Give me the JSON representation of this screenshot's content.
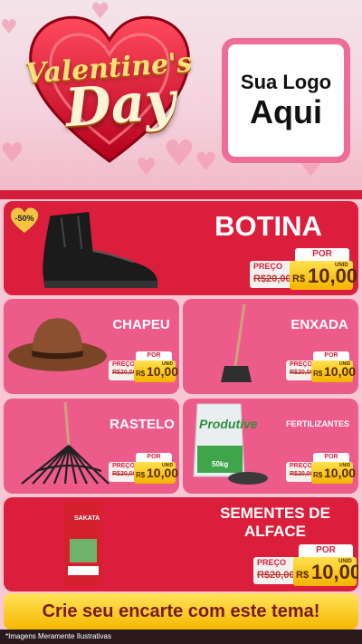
{
  "header": {
    "title_line1": "Valentine's",
    "title_line2": "Day",
    "logo_line1": "Sua Logo",
    "logo_line2": "Aqui"
  },
  "discount_badge": "-50%",
  "products": [
    {
      "name": "BOTINA",
      "por": "POR",
      "preco": "PREÇO",
      "old_price": "R$20,00",
      "currency": "R$",
      "price": "10,00",
      "unit": "UNID"
    },
    {
      "name": "CHAPEU",
      "por": "POR",
      "preco": "PREÇO",
      "old_price": "R$20,00",
      "currency": "R$",
      "price": "10,00",
      "unit": "UNID"
    },
    {
      "name": "ENXADA",
      "por": "POR",
      "preco": "PREÇO",
      "old_price": "R$20,00",
      "currency": "R$",
      "price": "10,00",
      "unit": "UNID"
    },
    {
      "name": "RASTELO",
      "por": "POR",
      "preco": "PREÇO",
      "old_price": "R$20,00",
      "currency": "R$",
      "price": "10,00",
      "unit": "UNID"
    },
    {
      "name": "FERTILIZANTES",
      "por": "POR",
      "preco": "PREÇO",
      "old_price": "R$20,00",
      "currency": "R$",
      "price": "10,00",
      "unit": "UNID",
      "bag_brand": "Produtive",
      "bag_weight": "50kg"
    },
    {
      "name_line1": "SEMENTES DE",
      "name_line2": "ALFACE",
      "por": "POR",
      "preco": "PREÇO",
      "old_price": "R$20,00",
      "currency": "R$",
      "price": "10,00",
      "unit": "UNID",
      "pack_brand": "SAKATA"
    }
  ],
  "cta": "Crie seu encarte com este tema!",
  "footer": "*Imagens Meramente Ilustrativas",
  "colors": {
    "red": "#da1e3c",
    "pink": "#ec5b8a",
    "gold": "#f4b300",
    "header_bg": "#f5d3de"
  }
}
